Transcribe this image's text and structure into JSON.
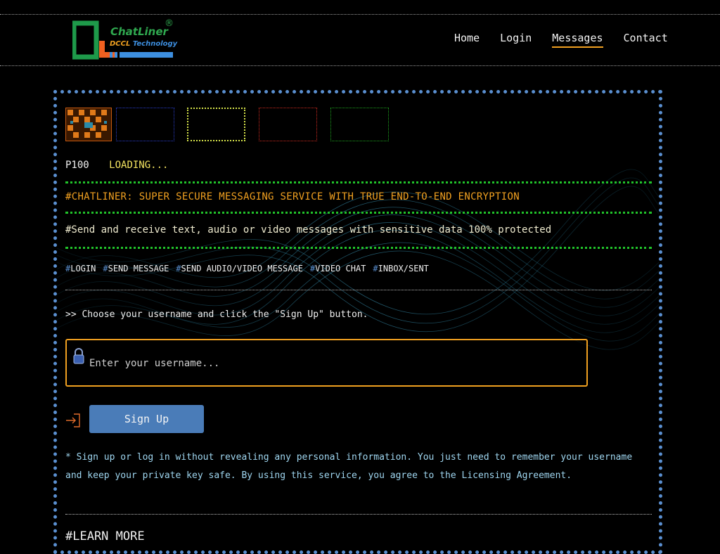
{
  "header": {
    "brand": "ChatLiner",
    "registered": "®",
    "sub_dccl": "DCCL",
    "sub_tech": "Technology",
    "nav": [
      {
        "label": "Home",
        "active": false
      },
      {
        "label": "Login",
        "active": false
      },
      {
        "label": "Messages",
        "active": true
      },
      {
        "label": "Contact",
        "active": false
      }
    ]
  },
  "main": {
    "status_code": "P100",
    "status_text": "LOADING...",
    "headline": "#CHATLINER: SUPER SECURE MESSAGING SERVICE WITH TRUE END-TO-END ENCRYPTION",
    "subline": "#Send and receive text, audio or video messages with sensitive data 100% protected",
    "tags": [
      {
        "hash": "#",
        "label": "LOGIN"
      },
      {
        "hash": "#",
        "label": "SEND MESSAGE"
      },
      {
        "hash": "#",
        "label": "SEND AUDIO/VIDEO MESSAGE"
      },
      {
        "hash": "#",
        "label": "VIDEO CHAT"
      },
      {
        "hash": "#",
        "label": "INBOX/SENT"
      }
    ],
    "instruction": ">> Choose your username and click the \"Sign Up\" button.",
    "username_placeholder": "Enter your username...",
    "username_value": "",
    "signup_label": "Sign Up",
    "note": "* Sign up or log in without revealing any personal information. You just need to remember your username and keep your private key safe. By using this service, you agree to the Licensing Agreement.",
    "learn_more": "#LEARN MORE"
  },
  "colors": {
    "accent_orange": "#f0a020",
    "accent_blue": "#4a7cb8",
    "divider_green": "#21c32a",
    "panel_border": "#5a8fd0"
  }
}
